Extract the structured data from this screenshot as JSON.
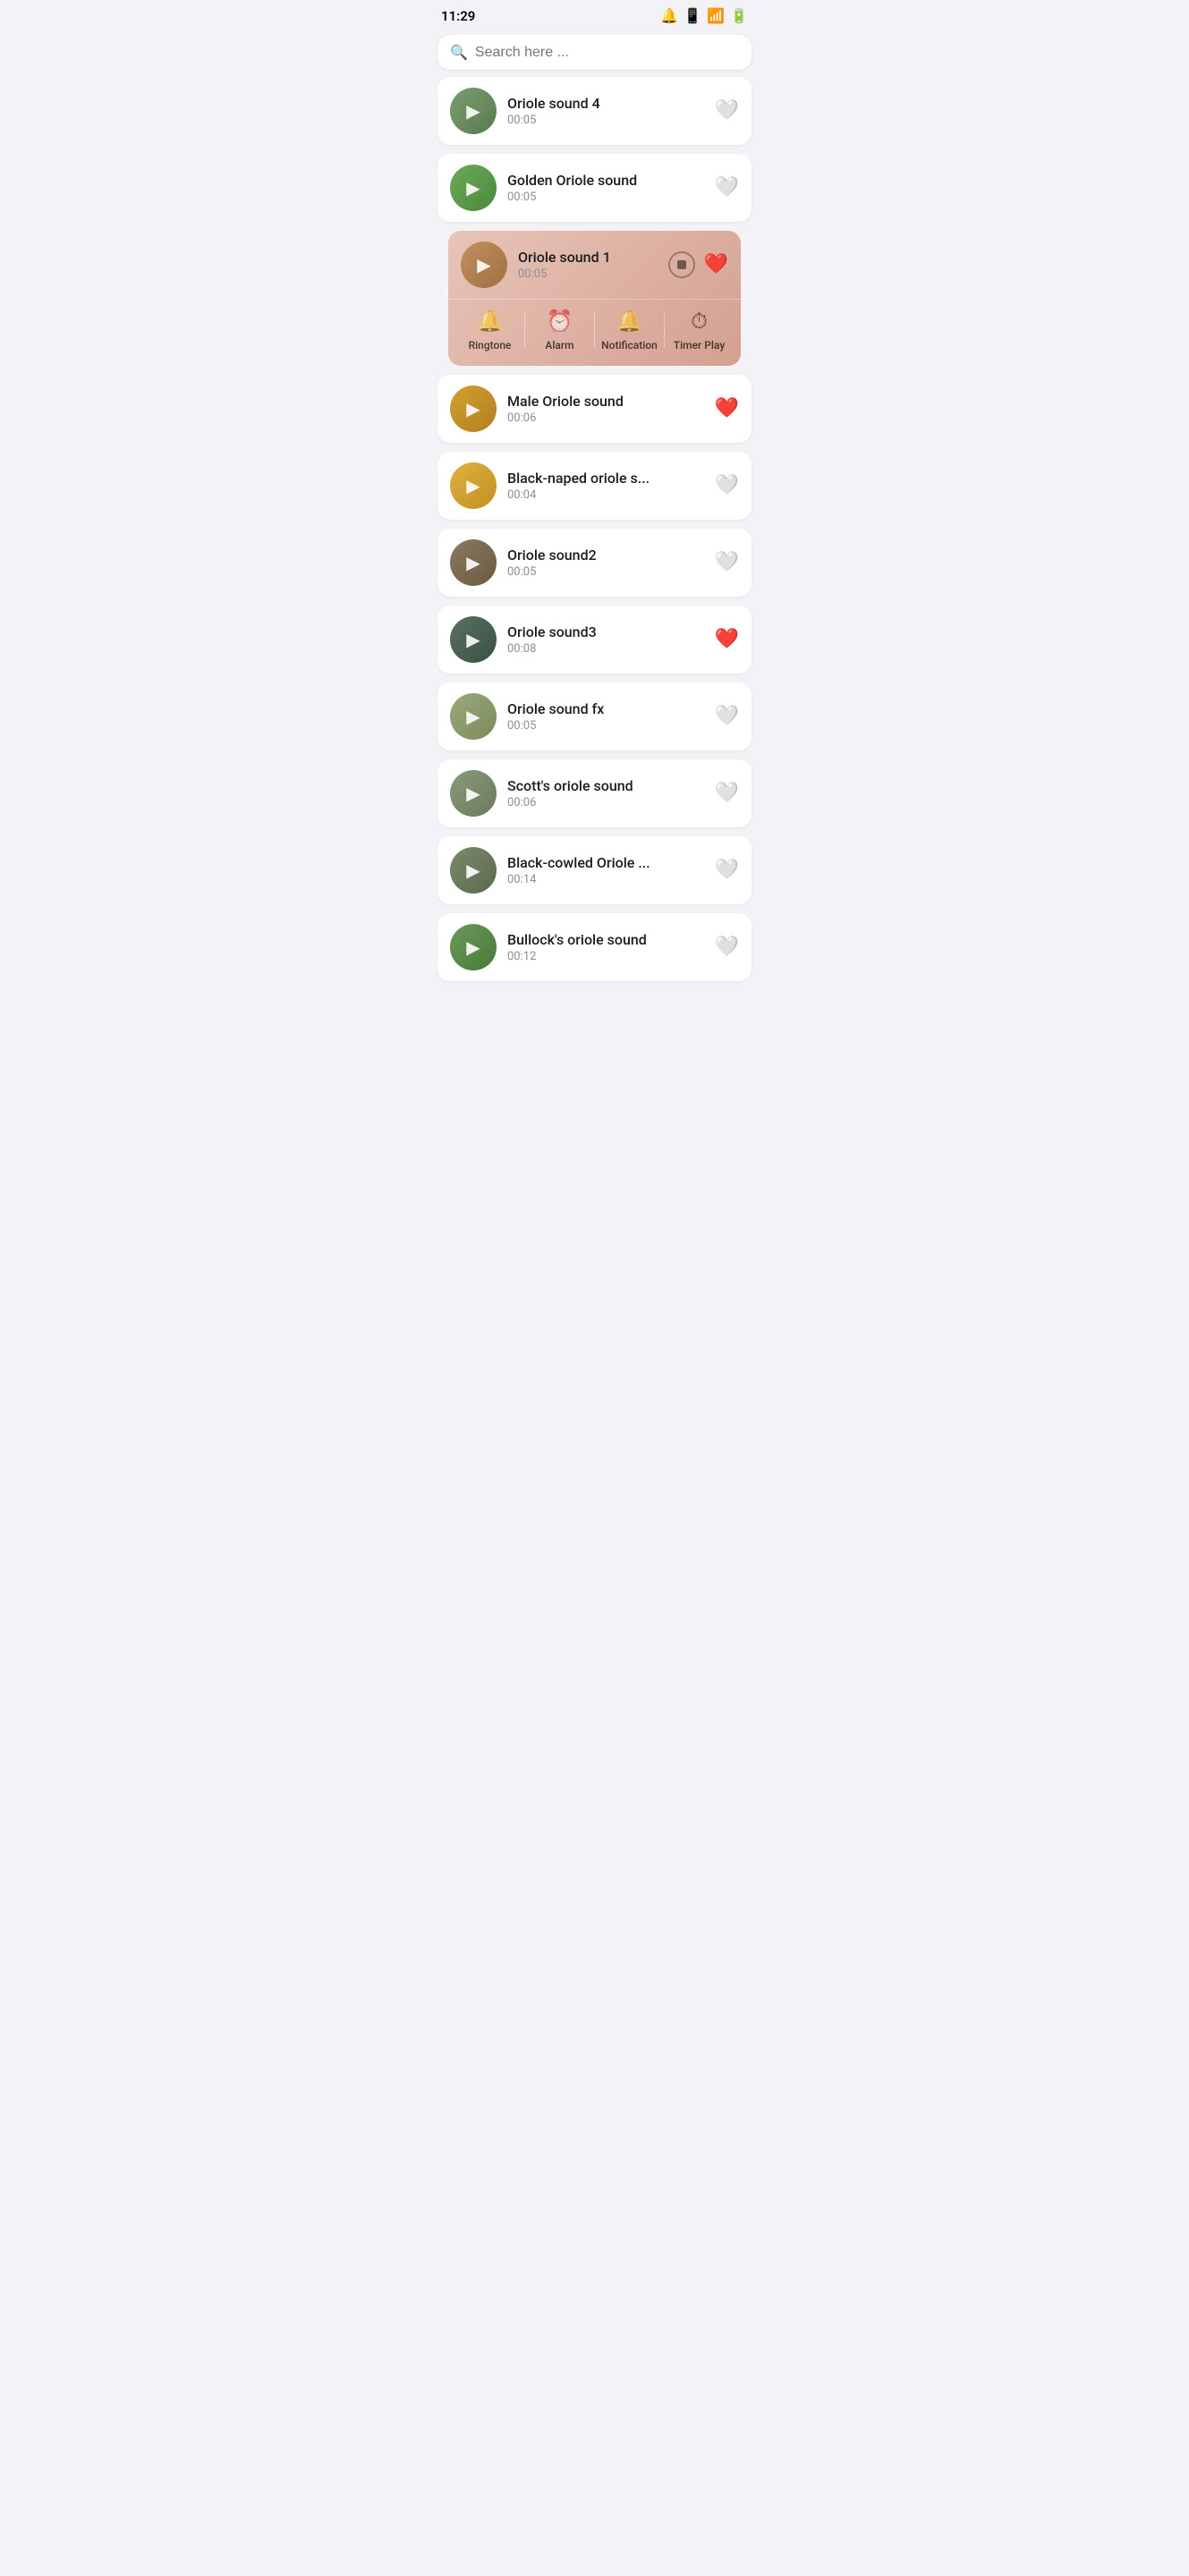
{
  "statusBar": {
    "time": "11:29"
  },
  "search": {
    "placeholder": "Search here ..."
  },
  "sounds": [
    {
      "id": 1,
      "name": "Oriole sound 4",
      "duration": "00:05",
      "liked": false,
      "playing": false,
      "avatarClass": "avatar-bg1"
    },
    {
      "id": 2,
      "name": "Golden Oriole sound",
      "duration": "00:05",
      "liked": false,
      "playing": false,
      "avatarClass": "avatar-bg2"
    },
    {
      "id": 3,
      "name": "Oriole sound 1",
      "duration": "00:05",
      "liked": true,
      "playing": true,
      "avatarClass": "avatar-bg3"
    },
    {
      "id": 4,
      "name": "Male Oriole sound",
      "duration": "00:06",
      "liked": true,
      "playing": false,
      "avatarClass": "avatar-bg4"
    },
    {
      "id": 5,
      "name": "Black-naped oriole s...",
      "duration": "00:04",
      "liked": false,
      "playing": false,
      "avatarClass": "avatar-bg5"
    },
    {
      "id": 6,
      "name": "Oriole sound2",
      "duration": "00:05",
      "liked": false,
      "playing": false,
      "avatarClass": "avatar-bg6"
    },
    {
      "id": 7,
      "name": "Oriole sound3",
      "duration": "00:08",
      "liked": true,
      "playing": false,
      "avatarClass": "avatar-bg7"
    },
    {
      "id": 8,
      "name": "Oriole sound fx",
      "duration": "00:05",
      "liked": false,
      "playing": false,
      "avatarClass": "avatar-bg8"
    },
    {
      "id": 9,
      "name": "Scott's oriole sound",
      "duration": "00:06",
      "liked": false,
      "playing": false,
      "avatarClass": "avatar-bg9"
    },
    {
      "id": 10,
      "name": "Black-cowled Oriole ...",
      "duration": "00:14",
      "liked": false,
      "playing": false,
      "avatarClass": "avatar-bg10"
    },
    {
      "id": 11,
      "name": "Bullock's oriole sound",
      "duration": "00:12",
      "liked": false,
      "playing": false,
      "avatarClass": "avatar-bg11"
    }
  ],
  "playerActions": [
    {
      "id": "ringtone",
      "icon": "🔔",
      "label": "Ringtone"
    },
    {
      "id": "alarm",
      "icon": "⏰",
      "label": "Alarm"
    },
    {
      "id": "notification",
      "icon": "🔔",
      "label": "Notification"
    },
    {
      "id": "timerplay",
      "icon": "⏱",
      "label": "Timer Play"
    }
  ]
}
